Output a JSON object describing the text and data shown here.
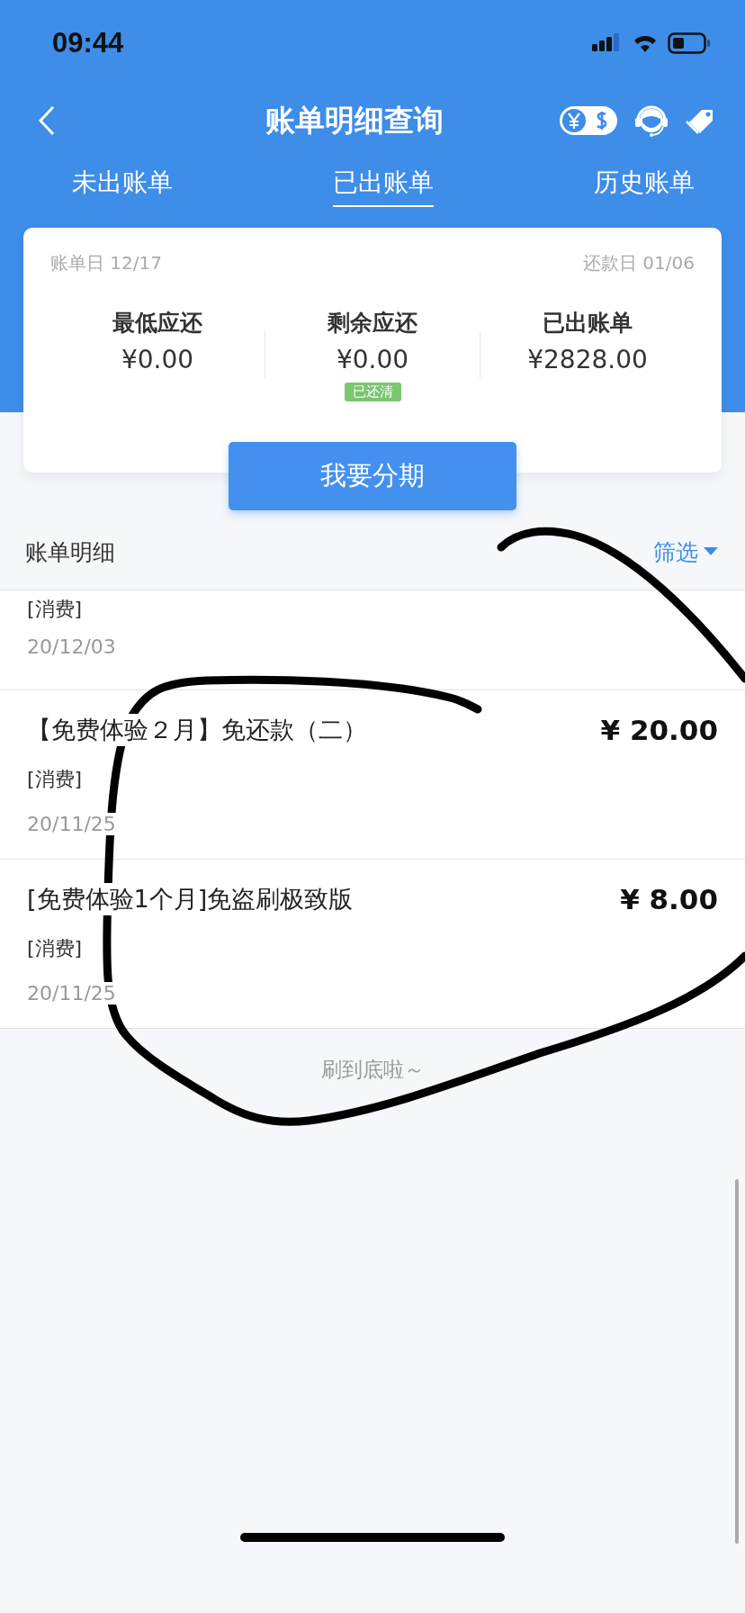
{
  "status_bar": {
    "time": "09:44"
  },
  "nav": {
    "title": "账单明细查询"
  },
  "tabs": [
    {
      "label": "未出账单",
      "selected": false
    },
    {
      "label": "已出账单",
      "selected": true
    },
    {
      "label": "历史账单",
      "selected": false
    }
  ],
  "summary": {
    "bill_day": "账单日 12/17",
    "due_day": "还款日 01/06",
    "stats": [
      {
        "label": "最低应还",
        "value": "¥0.00"
      },
      {
        "label": "剩余应还",
        "value": "¥0.00",
        "badge": "已还清"
      },
      {
        "label": "已出账单",
        "value": "¥2828.00"
      }
    ],
    "button": "我要分期"
  },
  "details": {
    "title": "账单明细",
    "filter": "筛选",
    "rows": [
      {
        "category": "[消费]",
        "date": "20/12/03"
      },
      {
        "title": "【免费体验２月】免还款（二）",
        "amount": "¥ 20.00",
        "category": "[消费]",
        "date": "20/11/25"
      },
      {
        "title": "[免费体验1个月]免盗刷极致版",
        "amount": "¥ 8.00",
        "category": "[消费]",
        "date": "20/11/25"
      }
    ],
    "footer": "刷到底啦～"
  }
}
